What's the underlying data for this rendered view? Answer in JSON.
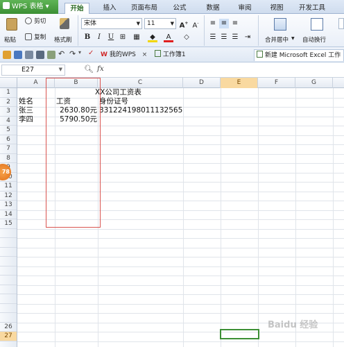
{
  "app": {
    "title": "WPS 表格",
    "menu_arrow": "▾"
  },
  "menu_tabs": [
    "开始",
    "插入",
    "页面布局",
    "公式",
    "数据",
    "审阅",
    "视图",
    "开发工具"
  ],
  "ribbon": {
    "paste_label": "粘贴",
    "cut_label": "剪切",
    "copy_label": "复制",
    "format_painter_label": "格式刷",
    "font_name": "宋体",
    "font_size": "11",
    "merge_center_label": "合并居中",
    "wrap_text_label": "自动换行"
  },
  "doc_tabs": {
    "my_wps": "我的WPS",
    "workbook": "工作簿1",
    "new_doc": "新建 Microsoft Excel 工作"
  },
  "formula_bar": {
    "cell_ref": "E27",
    "fx": "fx"
  },
  "grid": {
    "columns": [
      "A",
      "B",
      "C",
      "D",
      "E",
      "F",
      "G"
    ],
    "rows": [
      "1",
      "2",
      "3",
      "4",
      "5",
      "6",
      "7",
      "8",
      "9",
      "10",
      "11",
      "12",
      "13",
      "14",
      "15",
      "",
      "",
      "",
      "",
      "",
      "",
      "",
      "",
      "",
      "",
      "26",
      "27"
    ],
    "cells": {
      "c1": "XX公司工资表",
      "a2": "姓名",
      "b2": "工资",
      "c2": "身份证号",
      "a3": "张三",
      "b3": "2630.80元",
      "c3": "331224198011132565",
      "a4": "李四",
      "b4": "5790.50元"
    }
  },
  "badge": "78",
  "watermark": "Baidu 经验"
}
